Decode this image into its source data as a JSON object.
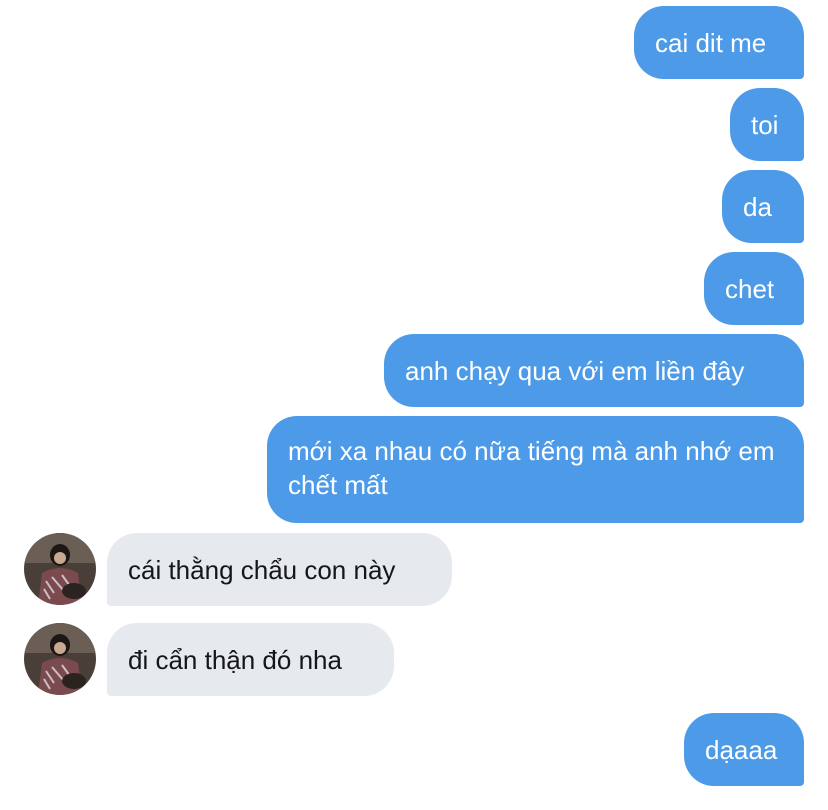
{
  "messages": [
    {
      "from": "me",
      "text": "cai dit me"
    },
    {
      "from": "me",
      "text": "toi"
    },
    {
      "from": "me",
      "text": "da"
    },
    {
      "from": "me",
      "text": "chet"
    },
    {
      "from": "me",
      "text": "anh chạy qua với em liền đây"
    },
    {
      "from": "me",
      "text": "mới xa nhau có nữa tiếng mà anh nhớ em chết mất"
    },
    {
      "from": "them",
      "text": "cái thằng chẩu con này"
    },
    {
      "from": "them",
      "text": "đi cẩn thận đó nha"
    },
    {
      "from": "me",
      "text": "dạaaa"
    }
  ],
  "colors": {
    "sent_bubble": "#4d9be8",
    "received_bubble": "#e6e9ee"
  }
}
